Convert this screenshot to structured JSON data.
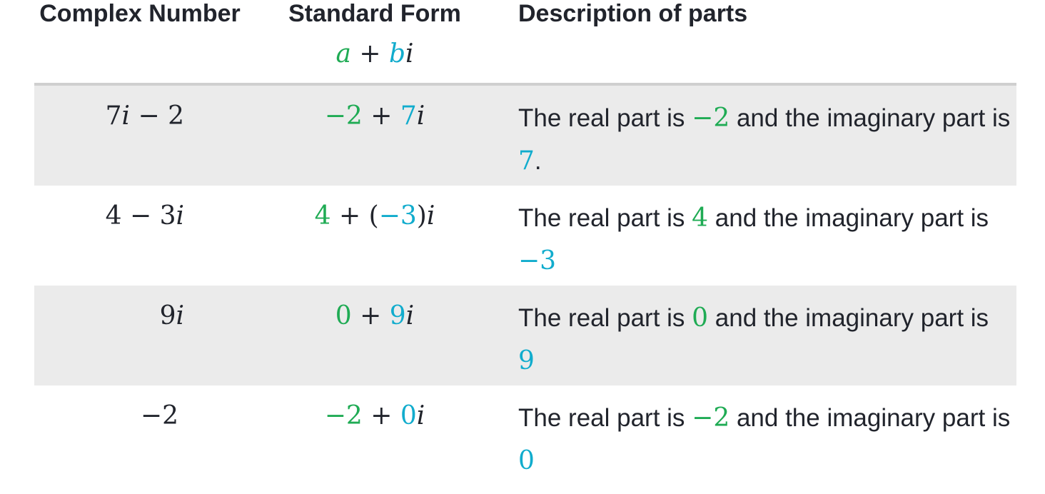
{
  "header": {
    "col1": "Complex Number",
    "col2": "Standard Form",
    "col2_formula": {
      "a": "a",
      "plus": " + ",
      "b": "b",
      "i": "i"
    },
    "col3": "Description of parts"
  },
  "colors": {
    "real": "#1fab54",
    "imaginary": "#11accd",
    "row_shade": "#ebebeb",
    "text": "#21242c"
  },
  "rows": [
    {
      "complex": {
        "pre": "7",
        "var": "i",
        "post": " − 2"
      },
      "standard": {
        "real": "−2",
        "mid": " + ",
        "imag": "7",
        "open": "",
        "close": "",
        "i": "i"
      },
      "desc": {
        "t1": "The real part is ",
        "real": "−2",
        "t2": " and the imaginary part is ",
        "imag": "7",
        "t3": "."
      }
    },
    {
      "complex": {
        "pre": "4 − 3",
        "var": "i",
        "post": ""
      },
      "standard": {
        "real": "4",
        "mid": " + (",
        "imag": "−3",
        "close": ")",
        "i": "i"
      },
      "desc": {
        "t1": "The real part is ",
        "real": "4",
        "t2": " and the imaginary part is ",
        "imag": "−3",
        "t3": ""
      }
    },
    {
      "complex": {
        "pre": "9",
        "var": "i",
        "post": ""
      },
      "standard": {
        "real": "0",
        "mid": " + ",
        "imag": "9",
        "close": "",
        "i": "i"
      },
      "desc": {
        "t1": "The real part is ",
        "real": "0",
        "t2": " and the imaginary part is ",
        "imag": "9",
        "t3": ""
      }
    },
    {
      "complex": {
        "pre": "−2",
        "var": "",
        "post": ""
      },
      "standard": {
        "real": "−2",
        "mid": " + ",
        "imag": "0",
        "close": "",
        "i": "i"
      },
      "desc": {
        "t1": "The real part is ",
        "real": "−2",
        "t2": " and the imaginary part is ",
        "imag": "0",
        "t3": ""
      }
    }
  ]
}
